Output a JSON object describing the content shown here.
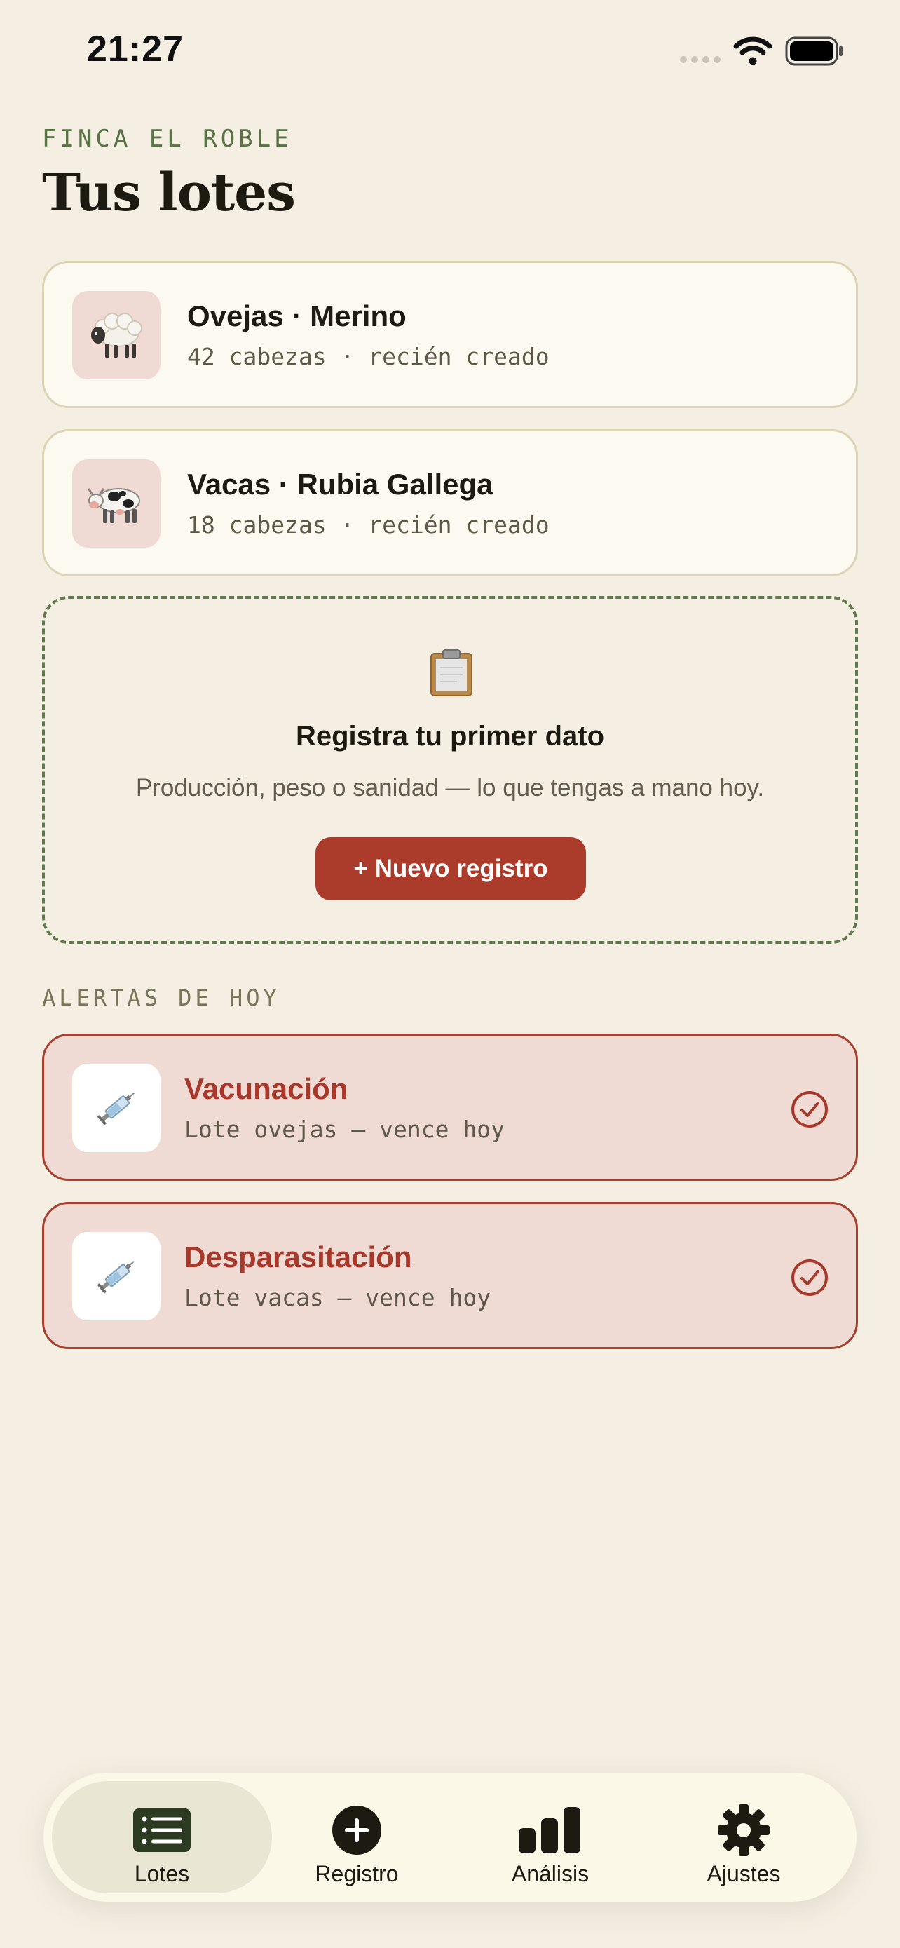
{
  "status_bar": {
    "time": "21:27"
  },
  "header": {
    "farm_name": "FINCA EL ROBLE",
    "title": "Tus lotes"
  },
  "herds": [
    {
      "name": "Ovejas · Merino",
      "meta": "42 cabezas · recién creado",
      "icon": "sheep-icon"
    },
    {
      "name": "Vacas · Rubia Gallega",
      "meta": "18 cabezas · recién creado",
      "icon": "cow-icon"
    }
  ],
  "empty_state": {
    "icon": "clipboard-icon",
    "title": "Registra tu primer dato",
    "description": "Producción, peso o sanidad — lo que tengas a mano hoy.",
    "button_label": "+ Nuevo registro"
  },
  "alerts_section": {
    "label": "ALERTAS DE HOY",
    "alerts": [
      {
        "title": "Vacunación",
        "meta": "Lote ovejas — vence hoy",
        "icon": "syringe-icon"
      },
      {
        "title": "Desparasitación",
        "meta": "Lote vacas — vence hoy",
        "icon": "syringe-icon"
      }
    ]
  },
  "tab_bar": {
    "tabs": [
      {
        "label": "Lotes",
        "icon": "list-icon",
        "active": true
      },
      {
        "label": "Registro",
        "icon": "plus-circle-icon",
        "active": false
      },
      {
        "label": "Análisis",
        "icon": "bar-chart-icon",
        "active": false
      },
      {
        "label": "Ajustes",
        "icon": "gear-icon",
        "active": false
      }
    ]
  },
  "colors": {
    "background": "#f5efe3",
    "accent_red": "#ab3b2b",
    "accent_green": "#5a7346",
    "alert_background": "#f0dbd4"
  }
}
